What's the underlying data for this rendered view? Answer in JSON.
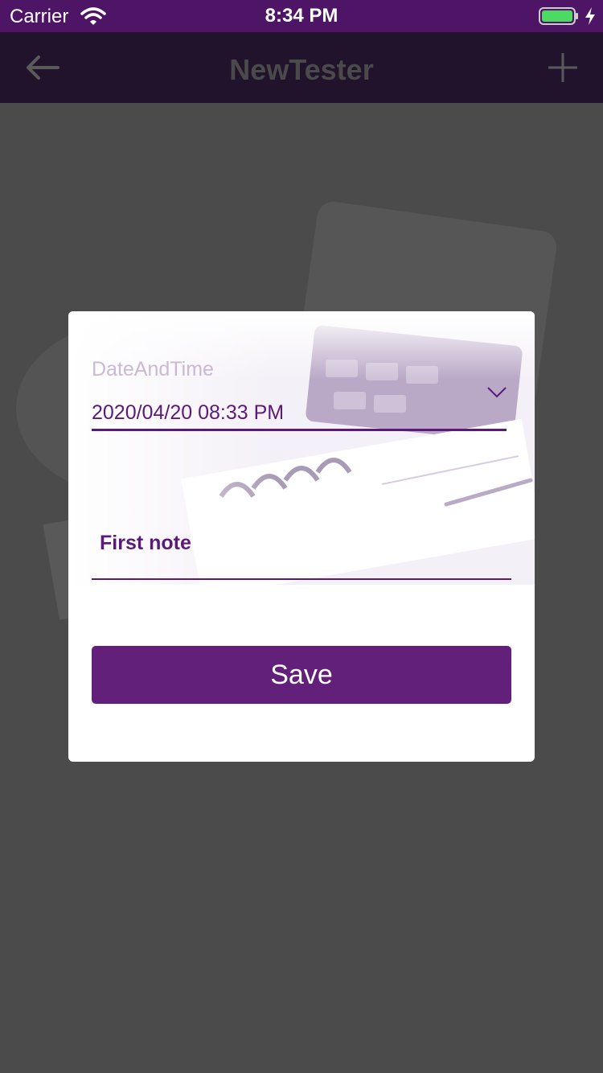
{
  "status_bar": {
    "carrier": "Carrier",
    "time": "8:34 PM",
    "icons": [
      "wifi-icon",
      "battery-icon",
      "charging-icon"
    ]
  },
  "nav": {
    "title": "NewTester",
    "back_icon": "back-arrow-icon",
    "add_icon": "plus-icon"
  },
  "dialog": {
    "date_field": {
      "label": "DateAndTime",
      "value": "2020/04/20 08:33 PM",
      "icon": "chevron-down-icon"
    },
    "note_field": {
      "value": "First note"
    },
    "save_label": "Save"
  },
  "colors": {
    "status_bar": "#4e1466",
    "nav_bar_dimmed": "#22132c",
    "overlay": "#4b4b4b",
    "accent": "#5b1a78",
    "button": "#63207a",
    "label_muted": "#cab9d3",
    "battery": "#4cd964"
  }
}
